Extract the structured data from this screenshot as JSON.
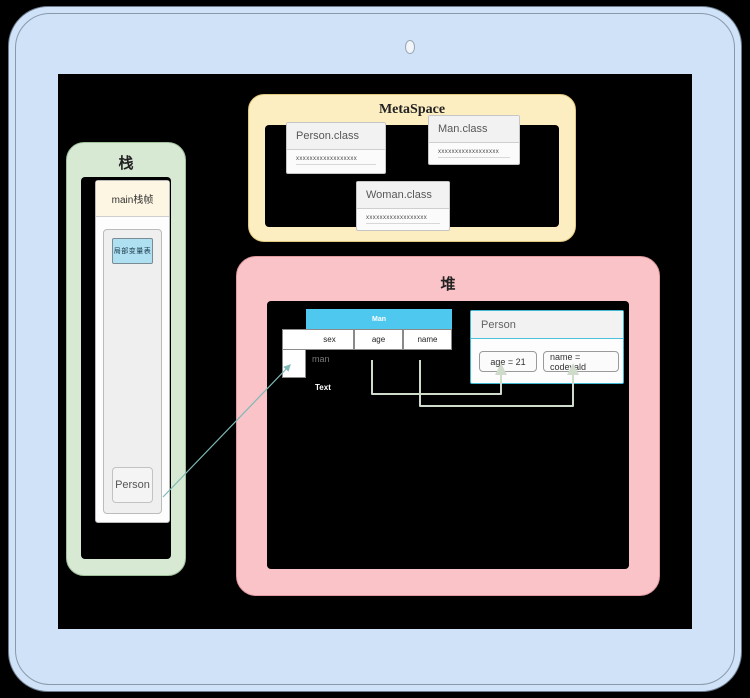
{
  "device": {
    "kind": "tablet-frame",
    "camera_icon": "camera-dot",
    "frame_color": "#cfe2f7",
    "screen_color": "#000000"
  },
  "stack": {
    "title": "栈",
    "region_color": "#d7e8d3",
    "frame": {
      "header": "main栈帧",
      "header_color": "#fdf6e3",
      "local_var_table": "局部变量表",
      "local_var_table_color": "#aee0f2",
      "reference": "Person"
    }
  },
  "metaspace": {
    "title": "MetaSpace",
    "region_color": "#fdeec2",
    "classes": [
      {
        "name": "Person.class",
        "body": "xxxxxxxxxxxxxxxxxx"
      },
      {
        "name": "Man.class",
        "body": "xxxxxxxxxxxxxxxxxx"
      },
      {
        "name": "Woman.class",
        "body": "xxxxxxxxxxxxxxxxxx"
      }
    ]
  },
  "heap": {
    "title": "堆",
    "region_color": "#f9c3c8",
    "man_table": {
      "header": "Man",
      "header_color": "#4fc8f0",
      "columns": [
        "sex",
        "age",
        "name"
      ],
      "value": "man",
      "caption": "Text"
    },
    "person_object": {
      "name": "Person",
      "accent_color": "#4cc1da",
      "fields": [
        {
          "label": "age = 21"
        },
        {
          "label": "name = codevald"
        }
      ]
    }
  },
  "connectors": {
    "stack_to_heap_color": "#7fb8b5",
    "field_link_color": "#cfdccb"
  }
}
